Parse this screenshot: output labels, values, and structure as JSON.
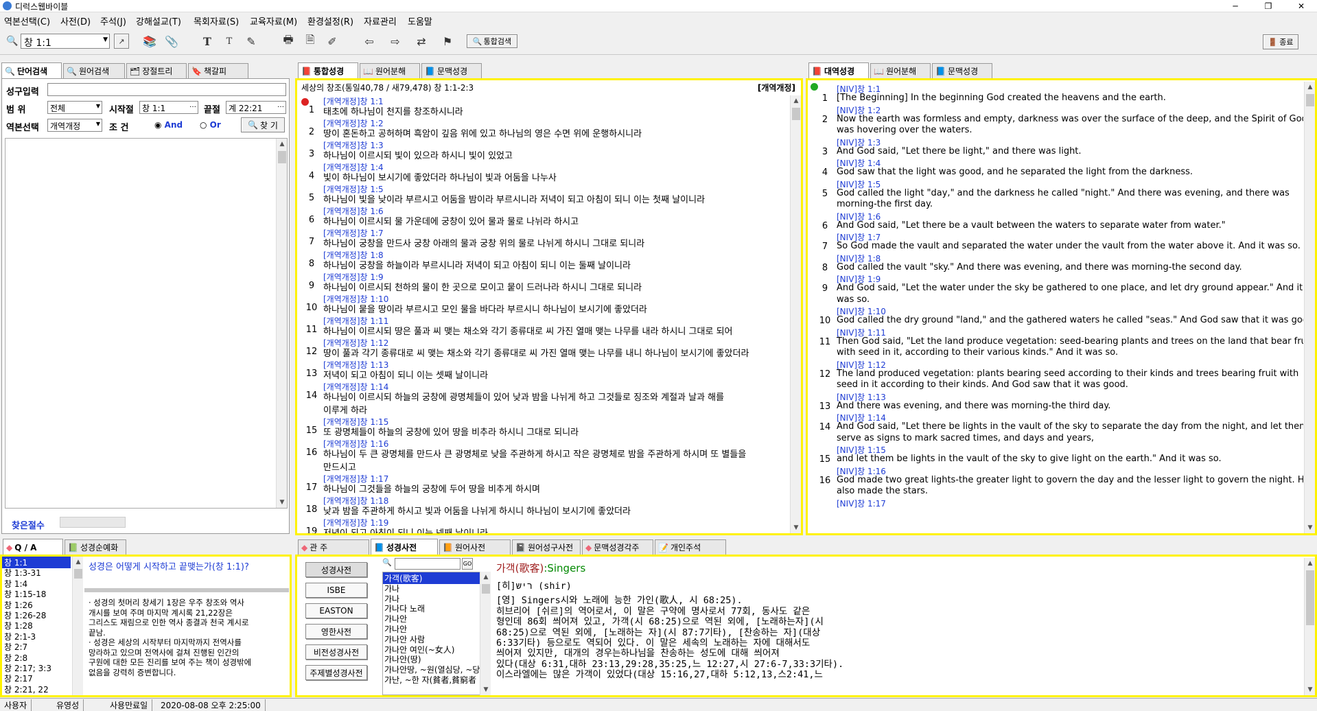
{
  "app": {
    "title": "디럭스웹바이블"
  },
  "menu": [
    "역본선택(C)",
    "사전(D)",
    "주석(J)",
    "강해설교(T)",
    "목회자료(S)",
    "교육자료(M)",
    "환경설정(R)",
    "자료관리",
    "도움말"
  ],
  "toolbar": {
    "ref_value": "창 1:1",
    "integrated_search": "통합검색",
    "exit": "종료"
  },
  "left_panel": {
    "tabs": [
      "단어검색",
      "원어검색",
      "장절트리",
      "책갈피"
    ],
    "phrase_label": "성구입력",
    "range_label": "범    위",
    "range_value": "전체",
    "start_label": "시작절",
    "start_value": "창 1:1",
    "end_label": "끝절",
    "end_value": "계 22:21",
    "version_label": "역본선택",
    "version_value": "개역개정",
    "cond_label": "조    건",
    "and_label": "And",
    "or_label": "Or",
    "find_button": "찾 기",
    "found_label": "찾은절수"
  },
  "center_panel": {
    "tabs": [
      "통합성경",
      "원어분해",
      "문맥성경"
    ],
    "header": "세상의 창조(통일40,78 / 새79,478) 창 1:1-2:3",
    "version_tag": "[개역개정]",
    "verses": [
      {
        "ref": "[개역개정]창 1:1",
        "num": "1",
        "lines": [
          "태초에 하나님이 천지를 창조하시니라"
        ]
      },
      {
        "ref": "[개역개정]창 1:2",
        "num": "2",
        "lines": [
          "땅이 혼돈하고 공허하며 흑암이 깊음 위에 있고 하나님의 영은 수면 위에 운행하시니라"
        ]
      },
      {
        "ref": "[개역개정]창 1:3",
        "num": "3",
        "lines": [
          "하나님이 이르시되 빛이 있으라 하시니 빛이 있었고"
        ]
      },
      {
        "ref": "[개역개정]창 1:4",
        "num": "4",
        "lines": [
          "빛이 하나님이 보시기에 좋았더라 하나님이 빛과 어둠을 나누사"
        ]
      },
      {
        "ref": "[개역개정]창 1:5",
        "num": "5",
        "lines": [
          "하나님이 빛을 낮이라 부르시고 어둠을 밤이라 부르시니라 저녁이 되고 아침이 되니 이는 첫째 날이니라"
        ]
      },
      {
        "ref": "[개역개정]창 1:6",
        "num": "6",
        "lines": [
          "하나님이 이르시되 물 가운데에 궁창이 있어 물과 물로 나뉘라 하시고"
        ]
      },
      {
        "ref": "[개역개정]창 1:7",
        "num": "7",
        "lines": [
          "하나님이 궁창을 만드사 궁창 아래의 물과 궁창 위의 물로 나뉘게 하시니 그대로 되니라"
        ]
      },
      {
        "ref": "[개역개정]창 1:8",
        "num": "8",
        "lines": [
          "하나님이 궁창을 하늘이라 부르시니라 저녁이 되고 아침이 되니 이는 둘째 날이니라"
        ]
      },
      {
        "ref": "[개역개정]창 1:9",
        "num": "9",
        "lines": [
          "하나님이 이르시되 천하의 물이 한 곳으로 모이고 뭍이 드러나라 하시니 그대로 되니라"
        ]
      },
      {
        "ref": "[개역개정]창 1:10",
        "num": "10",
        "lines": [
          "하나님이 뭍을 땅이라 부르시고 모인 물을 바다라 부르시니 하나님이 보시기에 좋았더라"
        ]
      },
      {
        "ref": "[개역개정]창 1:11",
        "num": "11",
        "lines": [
          "하나님이 이르시되 땅은 풀과 씨 맺는 채소와 각기 종류대로 씨 가진 열매 맺는 나무를 내라 하시니 그대로 되어"
        ]
      },
      {
        "ref": "[개역개정]창 1:12",
        "num": "12",
        "lines": [
          "땅이 풀과 각기 종류대로 씨 맺는 채소와 각기 종류대로 씨 가진 열매 맺는 나무를 내니 하나님이 보시기에 좋았더라"
        ]
      },
      {
        "ref": "[개역개정]창 1:13",
        "num": "13",
        "lines": [
          "저녁이 되고 아침이 되니 이는 셋째 날이니라"
        ]
      },
      {
        "ref": "[개역개정]창 1:14",
        "num": "14",
        "lines": [
          "하나님이 이르시되 하늘의 궁창에 광명체들이 있어 낮과 밤을 나뉘게 하고 그것들로 징조와 계절과 날과 해를",
          "이루게 하라"
        ]
      },
      {
        "ref": "[개역개정]창 1:15",
        "num": "15",
        "lines": [
          "또 광명체들이 하늘의 궁창에 있어 땅을 비추라 하시니 그대로 되니라"
        ]
      },
      {
        "ref": "[개역개정]창 1:16",
        "num": "16",
        "lines": [
          "하나님이 두 큰 광명체를 만드사 큰 광명체로 낮을 주관하게 하시고 작은 광명체로 밤을 주관하게 하시며 또 별들을",
          "만드시고"
        ]
      },
      {
        "ref": "[개역개정]창 1:17",
        "num": "17",
        "lines": [
          "하나님이 그것들을 하늘의 궁창에 두어 땅을 비추게 하시며"
        ]
      },
      {
        "ref": "[개역개정]창 1:18",
        "num": "18",
        "lines": [
          "낮과 밤을 주관하게 하시고 빛과 어둠을 나뉘게 하시니 하나님이 보시기에 좋았더라"
        ]
      },
      {
        "ref": "[개역개정]창 1:19",
        "num": "19",
        "lines": [
          "저녁이 되고 아침이 되니 이는 넷째 날이니라"
        ]
      }
    ]
  },
  "right_panel": {
    "tabs": [
      "대역성경",
      "원어분해",
      "문맥성경"
    ],
    "verses": [
      {
        "ref": "[NIV]창 1:1",
        "num": "1",
        "lines": [
          "[The Beginning] In the beginning God created the heavens and the earth."
        ]
      },
      {
        "ref": "[NIV]창 1:2",
        "num": "2",
        "lines": [
          "Now the earth was formless and empty, darkness was over the surface of the deep, and the Spirit of God",
          "was hovering over the waters."
        ]
      },
      {
        "ref": "[NIV]창 1:3",
        "num": "3",
        "lines": [
          "And God said, \"Let there be light,\" and there was light."
        ]
      },
      {
        "ref": "[NIV]창 1:4",
        "num": "4",
        "lines": [
          "God saw that the light was good, and he separated the light from the darkness."
        ]
      },
      {
        "ref": "[NIV]창 1:5",
        "num": "5",
        "lines": [
          "God called the light \"day,\" and the darkness he called \"night.\" And there was evening, and there was",
          "morning-the first day."
        ]
      },
      {
        "ref": "[NIV]창 1:6",
        "num": "6",
        "lines": [
          "And God said, \"Let there be a vault between the waters to separate water from water.\""
        ]
      },
      {
        "ref": "[NIV]창 1:7",
        "num": "7",
        "lines": [
          "So God made the vault and separated the water under the vault from the water above it. And it was so."
        ]
      },
      {
        "ref": "[NIV]창 1:8",
        "num": "8",
        "lines": [
          "God called the vault \"sky.\" And there was evening, and there was morning-the second day."
        ]
      },
      {
        "ref": "[NIV]창 1:9",
        "num": "9",
        "lines": [
          "And God said, \"Let the water under the sky be gathered to one place, and let dry ground appear.\" And it",
          "was so."
        ]
      },
      {
        "ref": "[NIV]창 1:10",
        "num": "10",
        "lines": [
          "God called the dry ground \"land,\" and the gathered waters he called \"seas.\" And God saw that it was good."
        ]
      },
      {
        "ref": "[NIV]창 1:11",
        "num": "11",
        "lines": [
          "Then God said, \"Let the land produce vegetation: seed-bearing plants and trees on the land that bear fruit",
          "with seed in it, according to their various kinds.\" And it was so."
        ]
      },
      {
        "ref": "[NIV]창 1:12",
        "num": "12",
        "lines": [
          "The land produced vegetation: plants bearing seed according to their kinds and trees bearing fruit with",
          "seed in it according to their kinds. And God saw that it was good."
        ]
      },
      {
        "ref": "[NIV]창 1:13",
        "num": "13",
        "lines": [
          "And there was evening, and there was morning-the third day."
        ]
      },
      {
        "ref": "[NIV]창 1:14",
        "num": "14",
        "lines": [
          "And God said, \"Let there be lights in the vault of the sky to separate the day from the night, and let them",
          "serve as signs to mark sacred times, and days and years,"
        ]
      },
      {
        "ref": "[NIV]창 1:15",
        "num": "15",
        "lines": [
          "and let them be lights in the vault of the sky to give light on the earth.\" And it was so."
        ]
      },
      {
        "ref": "[NIV]창 1:16",
        "num": "16",
        "lines": [
          "God made two great lights-the greater light to govern the day and the lesser light to govern the night. He",
          "also made the stars."
        ]
      },
      {
        "ref": "[NIV]창 1:17",
        "num": "",
        "lines": []
      }
    ]
  },
  "qa_panel": {
    "tabs": [
      "Q / A",
      "성경순예화"
    ],
    "list": [
      "창 1:1",
      "창 1:3-31",
      "창 1:4",
      "창 1:15-18",
      "창 1:26",
      "창 1:26-28",
      "창 1:28",
      "창 2:1-3",
      "창 2:7",
      "창 2:8",
      "창 2:17; 3:3",
      "창 2:17",
      "창 2:21, 22"
    ],
    "question": "성경은 어떻게 시작하고 끝맺는가(창 1:1)?",
    "answer": [
      "· 성경의 첫머리 창세기 1장은 우주 창조와 역사",
      "개시를 보여 주며 마지막 계시록 21,22장은",
      "그리스도 재림으로 인한 역사 종결과 천국 계시로",
      "끝남.",
      "· 성경은 세상의 시작부터 마지막까지 전역사를",
      "망라하고 있으며 전역사에 걸쳐 진행된 인간의",
      "구원에 대한 모든 진리를 보여 주는 책이 성경밖에",
      "없음을 강력히 증변합니다."
    ]
  },
  "dict_panel": {
    "tabs": [
      "관 주",
      "성경사전",
      "원어사전",
      "원어성구사전",
      "문맥성경각주",
      "개인주석"
    ],
    "buttons": [
      "성경사전",
      "ISBE",
      "EASTON",
      "영한사전",
      "비전성경사전",
      "주제별성경사전"
    ],
    "search_go": "GO",
    "words": [
      "가객(歌客)",
      "가나",
      "가나",
      "가나다 노래",
      "가나안",
      "가나안",
      "가나안 사람",
      "가나안 여인(~女人)",
      "가나안(땅)",
      "가나안땅, ~원(열심당, ~당)",
      "가난, ~한 자(貧者,貧窮者"
    ],
    "entry_title": "가객(歌客)",
    "entry_en": ":Singers",
    "entry_lines": [
      "[히]ריש (shir)",
      "[영] Singers시와 노래에 능한 가인(歌人, 시 68:25).",
      " 히브리어 [쉬르]의 역어로서, 이 말은 구약에 명사로서 77회, 동사도 같은",
      "형인데 86회 씌어져 있고, 가객(시 68:25)으로 역된 외에, [노래하는자](시",
      "68:25)으로 역된 외에, [노래하는 자](시 87:7기타), [찬송하는 자](대상",
      "6:33기타) 등으로도 역되어 있다. 이 말은 세속의 노래하는 자에 대해서도",
      "씌어져 있지만, 대개의 경우는하나님을 찬송하는 성도에 대해 씌어져",
      "있다(대상 6:31,대하 23:13,29:28,35:25,느 12:27,시 27:6-7,33:3기타).",
      "이스라엘에는 많은 가객이 있었다(대상 15:16,27,대하 5:12,13,스2:41,느"
    ]
  },
  "status": {
    "user_label": "사용자",
    "user_value": "유영성",
    "expire_label": "사용만료일",
    "expire_value": "2020-08-08 오후 2:25:00"
  }
}
